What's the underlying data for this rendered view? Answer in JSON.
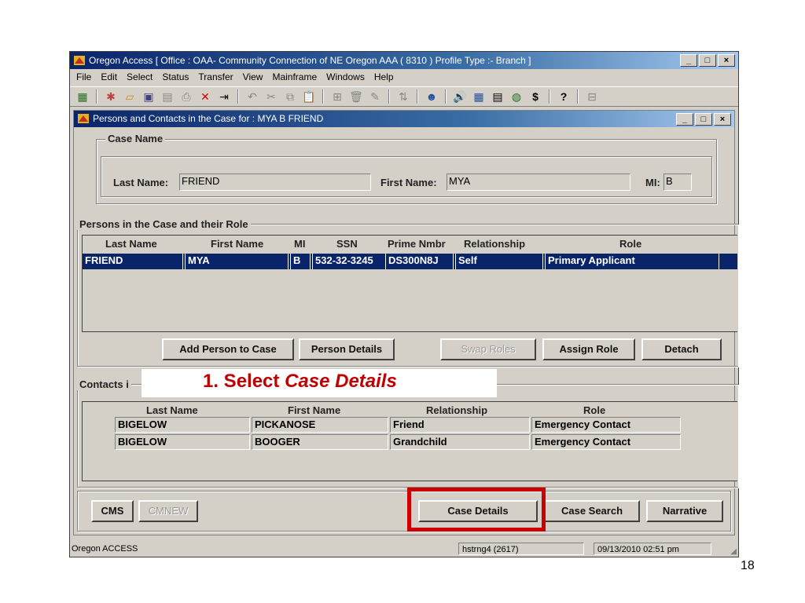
{
  "app": {
    "title": "Oregon Access [ Office : OAA- Community Connection of NE Oregon AAA ( 8310 ) Profile Type :- Branch ]",
    "menu": [
      "File",
      "Edit",
      "Select",
      "Status",
      "Transfer",
      "View",
      "Mainframe",
      "Windows",
      "Help"
    ],
    "window_buttons": [
      "_",
      "□",
      "×"
    ]
  },
  "dialog": {
    "title": "Persons and Contacts in the Case for : MYA B FRIEND",
    "case_name": {
      "legend": "Case Name",
      "last_name_label": "Last Name:",
      "last_name": "FRIEND",
      "first_name_label": "First Name:",
      "first_name": "MYA",
      "mi_label": "MI:",
      "mi": "B"
    },
    "persons": {
      "legend": "Persons in the Case and their Role",
      "columns": [
        "Last Name",
        "First Name",
        "MI",
        "SSN",
        "Prime Nmbr",
        "Relationship",
        "Role"
      ],
      "rows": [
        [
          "FRIEND",
          "MYA",
          "B",
          "532-32-3245",
          "DS300N8J",
          "Self",
          "Primary Applicant"
        ]
      ],
      "buttons": {
        "add": "Add Person to Case",
        "details": "Person Details",
        "swap": "Swap Roles",
        "assign": "Assign Role",
        "detach": "Detach"
      }
    },
    "contacts": {
      "legend": "Contacts i",
      "columns": [
        "Last Name",
        "First Name",
        "Relationship",
        "Role"
      ],
      "rows": [
        [
          "BIGELOW",
          "PICKANOSE",
          "Friend",
          "Emergency Contact"
        ],
        [
          "BIGELOW",
          "BOOGER",
          "Grandchild",
          "Emergency Contact"
        ]
      ]
    },
    "footer_buttons": {
      "cms": "CMS",
      "cmnew": "CMNEW",
      "case_details": "Case Details",
      "case_search": "Case Search",
      "narrative": "Narrative"
    }
  },
  "status": {
    "app": "Oregon ACCESS",
    "user": "hstrng4 (2617)",
    "datetime": "09/13/2010 02:51 pm"
  },
  "callout": {
    "prefix": "1.  Select ",
    "emph": "Case Details"
  },
  "slide_number": "18",
  "colors": {
    "highlight": "#cc0000",
    "selection": "#0a246a",
    "callout_text": "#c00000"
  }
}
